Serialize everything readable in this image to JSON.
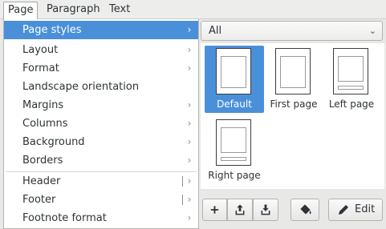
{
  "menubar": {
    "tabs": [
      {
        "label": "Page"
      },
      {
        "label": "Paragraph"
      },
      {
        "label": "Text"
      }
    ]
  },
  "menu": {
    "items": [
      {
        "label": "Page styles",
        "submenu": true
      },
      {
        "label": "Layout",
        "submenu": true
      },
      {
        "label": "Format",
        "submenu": true
      },
      {
        "label": "Landscape orientation",
        "submenu": false
      },
      {
        "label": "Margins",
        "submenu": true
      },
      {
        "label": "Columns",
        "submenu": true
      },
      {
        "label": "Background",
        "submenu": true
      },
      {
        "label": "Borders",
        "submenu": true
      },
      {
        "label": "Header",
        "submenu": true,
        "split": true
      },
      {
        "label": "Footer",
        "submenu": true,
        "split": true
      },
      {
        "label": "Footnote format",
        "submenu": true
      }
    ],
    "highlighted_index": 0
  },
  "panel": {
    "filter": {
      "selected": "All"
    },
    "styles": [
      {
        "label": "Default",
        "selected": true
      },
      {
        "label": "First page",
        "selected": false
      },
      {
        "label": "Left page",
        "selected": false
      },
      {
        "label": "Right page",
        "selected": false
      }
    ],
    "toolbar": {
      "edit_label": "Edit"
    }
  },
  "icons": {
    "submenu": "chevron-right-icon",
    "dropdown": "chevron-down-icon",
    "new": "plus-icon",
    "update": "upload-icon",
    "load": "download-icon",
    "fill": "paint-bucket-icon",
    "edit": "pencil-icon"
  },
  "colors": {
    "accent": "#4a90d9",
    "menu_bg": "#ffffff",
    "panel_bg": "#e8e8e7"
  }
}
